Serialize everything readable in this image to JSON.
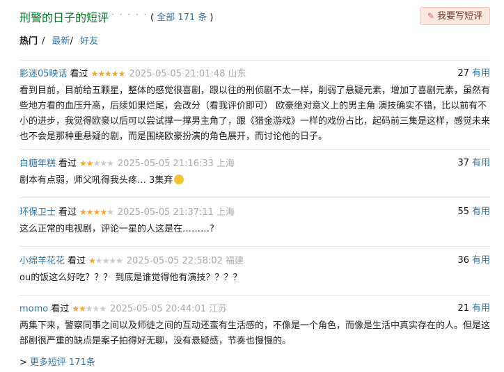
{
  "header": {
    "title": "刑警的日子的短评",
    "dots": "· · · · · ·",
    "total_prefix": "( ",
    "total_link": "全部 171 条",
    "total_suffix": " )",
    "write_label": "我要写短评"
  },
  "tabs": {
    "hot": "热门",
    "latest": "最新",
    "friends": "好友",
    "sep": "/"
  },
  "comments": [
    {
      "user": "影迷05映话",
      "status": "看过",
      "rating": 5,
      "time": "2025-05-05 21:01:48",
      "location": "山东",
      "votes": "27",
      "useful": "有用",
      "text": "看到目前，目前给五颗星，整体的感觉很喜剧，跟以往的刑侦剧不太一样，削弱了悬疑元素，增加了喜剧元素，虽然有些地方看的血压升高，后续如果烂尾，会改分（看我评价即可） 欧豪绝对意义上的男主角 演技确实不错，比以前有不小的进步，我觉得欧豪以后可以尝试撑一撑男主角了，跟《猎金游戏》一样的戏份占比，起码前三集是这样，感觉未来也不会是那种重悬疑的剧，而是围绕欧豪扮演的角色展开，而讨论他的日子。"
    },
    {
      "user": "白糖年糕",
      "status": "看过",
      "rating": 2,
      "time": "2025-05-05 21:16:33",
      "location": "上海",
      "votes": "37",
      "useful": "有用",
      "text": "剧本有点弱，师父吼得我头疼… 3集弃"
    },
    {
      "user": "环保卫士",
      "status": "看过",
      "rating": 4,
      "time": "2025-05-05 21:37:11",
      "location": "上海",
      "votes": "55",
      "useful": "有用",
      "text": "这么正常的电视剧，评论一星的人这是在………?"
    },
    {
      "user": "小绵羊花花",
      "status": "看过",
      "rating": 1,
      "time": "2025-05-05 22:58:02",
      "location": "福建",
      "votes": "36",
      "useful": "有用",
      "text": "ou的饭这么好吃？？？ 到底是谁觉得他有演技？？？？"
    },
    {
      "user": "momo",
      "status": "看过",
      "rating": 2,
      "time": "2025-05-05 20:44:01",
      "location": "江苏",
      "votes": "21",
      "useful": "有用",
      "text": "两集下来，警察同事之间以及师徒之间的互动还蛮有生活感的，不像是一个角色，而像是生活中真实存在的人。但是这部剧很严重的缺点是案子拍得好无聊，没有悬疑感，节奏也慢慢的。"
    }
  ],
  "more": {
    "arrow": ">",
    "label": "更多短评 171条"
  },
  "colors": {
    "title": "#007722",
    "link": "#3377aa",
    "star": "#f5a623",
    "button_bg": "#fde8df"
  }
}
